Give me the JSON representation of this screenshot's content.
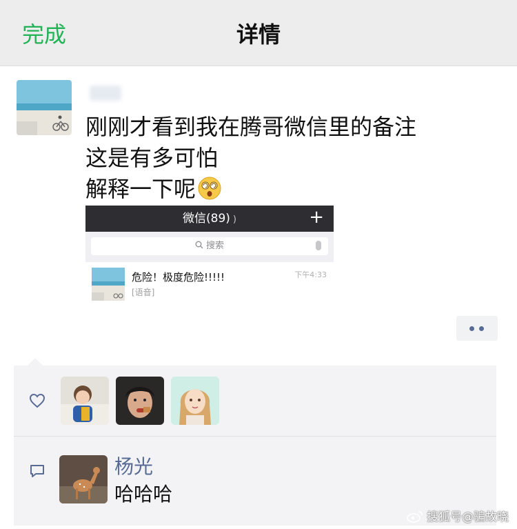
{
  "header": {
    "done_label": "完成",
    "title": "详情"
  },
  "post": {
    "lines": [
      "刚刚才看到我在腾哥微信里的备注",
      "这是有多可怕",
      "解释一下呢"
    ],
    "emoji": "dizzy-face-emoji"
  },
  "screenshot": {
    "title": "微信(89)",
    "search_placeholder": "搜索",
    "chat": {
      "name": "危险！极度危险!!!!!",
      "preview": "[语音]",
      "time": "下午4:33"
    }
  },
  "likes": {
    "icon": "heart-icon",
    "count_shown": 3
  },
  "comment": {
    "author": "杨光",
    "text": "哈哈哈",
    "icon": "comment-icon"
  },
  "watermark": {
    "text": "搜狐号@骗故晓"
  },
  "colors": {
    "accent_green": "#21b356",
    "link_blue": "#576b95",
    "header_bg": "#ededed",
    "panel_bg": "#f3f3f5"
  }
}
